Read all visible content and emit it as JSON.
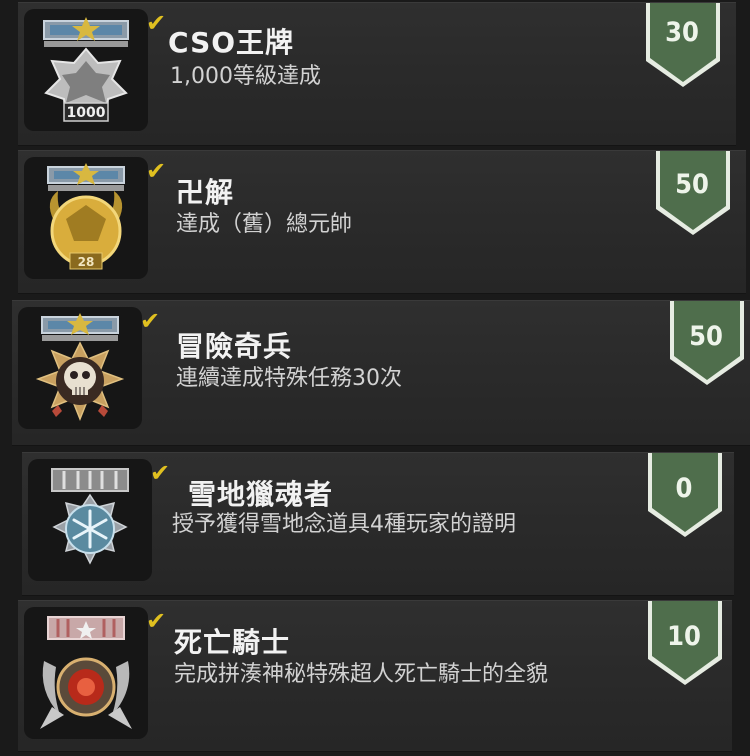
{
  "achievements": [
    {
      "title": "CSO王牌",
      "description": "1,000等級達成",
      "points": "30",
      "medal_level": "1000",
      "medal": "ace-medal-icon"
    },
    {
      "title": "卍解",
      "description": "達成（舊）總元帥",
      "points": "50",
      "medal_level": "28",
      "medal": "gold-marshal-medal-icon"
    },
    {
      "title": "冒險奇兵",
      "description": "連續達成特殊任務30次",
      "points": "50",
      "medal_level": "",
      "medal": "skull-medal-icon"
    },
    {
      "title": "雪地獵魂者",
      "description": "授予獲得雪地念道具4種玩家的證明",
      "points": "0",
      "medal_level": "",
      "medal": "snowflake-medal-icon"
    },
    {
      "title": "死亡騎士",
      "description": "完成拼湊神秘特殊超人死亡騎士的全貌",
      "points": "10",
      "medal_level": "",
      "medal": "death-knight-medal-icon"
    }
  ],
  "colors": {
    "badge_green": "#4f6e4c",
    "check_yellow": "#e0c020"
  }
}
